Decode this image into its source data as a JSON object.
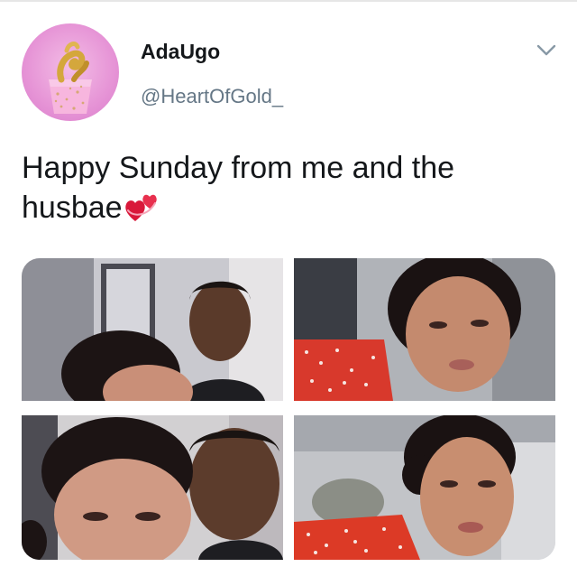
{
  "tweet": {
    "display_name": "AdaUgo",
    "handle": "@HeartOfGold_",
    "text": "Happy Sunday from me and the husbae",
    "emoji": "revolving-hearts-icon"
  },
  "media": {
    "photo_count": 4
  },
  "colors": {
    "text": "#14171a",
    "secondary": "#657786",
    "avatar_bg": "#e694d6",
    "heart": "#e0245e"
  }
}
